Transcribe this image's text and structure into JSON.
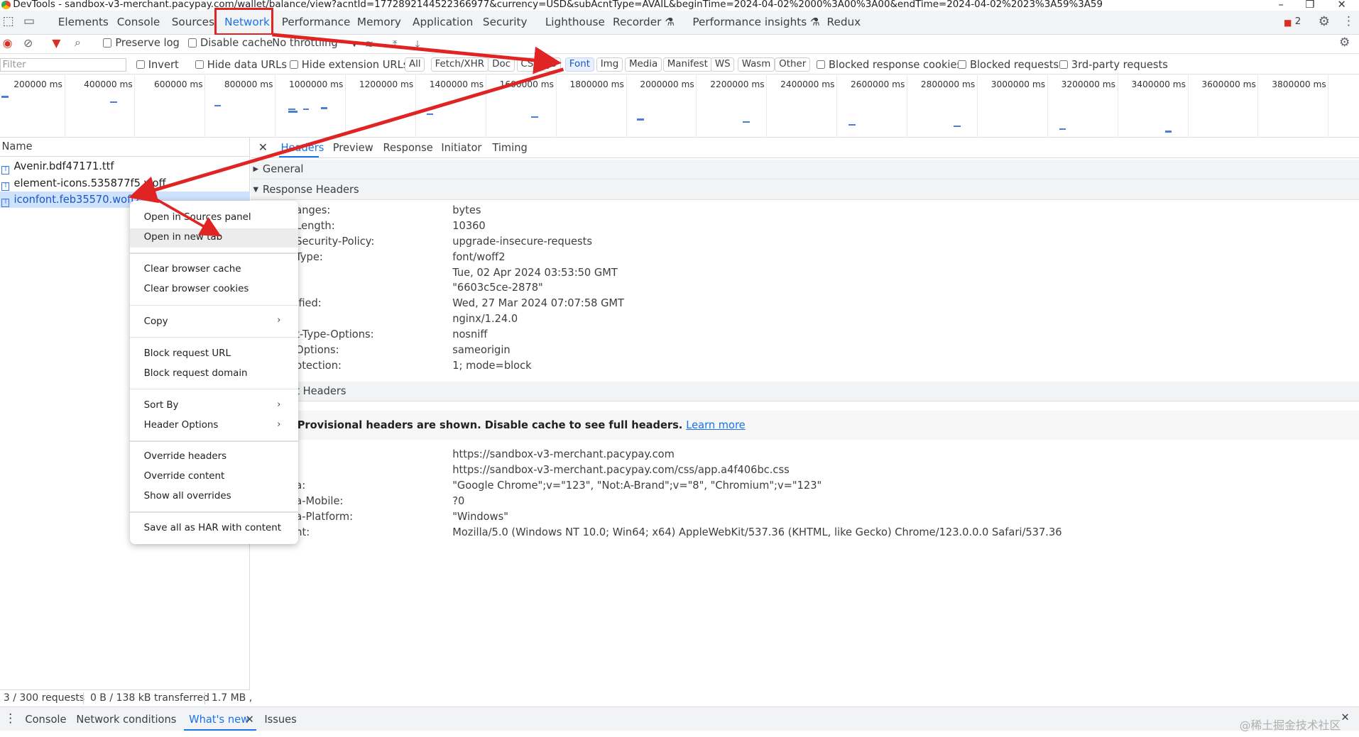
{
  "window": {
    "title": "DevTools - sandbox-v3-merchant.pacypay.com/wallet/balance/view?acntId=1772892144522366977&currency=USD&subAcntType=AVAIL&beginTime=2024-04-02%2000%3A00%3A00&endTime=2024-04-02%2023%3A59%3A59",
    "minimize": "–",
    "restore": "❐",
    "close": "✕"
  },
  "topbar": {
    "tabs": [
      "Elements",
      "Console",
      "Sources",
      "Network",
      "Performance",
      "Memory",
      "Application",
      "Security",
      "Lighthouse",
      "Recorder ⚗",
      "Performance insights ⚗",
      "Redux"
    ],
    "active_tab": "Network",
    "error_count": "2"
  },
  "toolbar": {
    "preserve_log": "Preserve log",
    "disable_cache": "Disable cache",
    "throttling": "No throttling"
  },
  "filterbar": {
    "filter_placeholder": "Filter",
    "invert": "Invert",
    "hide_data_urls": "Hide data URLs",
    "hide_extension_urls": "Hide extension URLs",
    "types": [
      "All",
      "Fetch/XHR",
      "Doc",
      "CSS",
      "JS",
      "Font",
      "Img",
      "Media",
      "Manifest",
      "WS",
      "Wasm",
      "Other"
    ],
    "active_type": "Font",
    "blocked_response_cookies": "Blocked response cookies",
    "blocked_requests": "Blocked requests",
    "third_party_requests": "3rd-party requests"
  },
  "timeline": {
    "ticks": [
      "200000 ms",
      "400000 ms",
      "600000 ms",
      "800000 ms",
      "1000000 ms",
      "1200000 ms",
      "1400000 ms",
      "1600000 ms",
      "1800000 ms",
      "2000000 ms",
      "2200000 ms",
      "2400000 ms",
      "2600000 ms",
      "2800000 ms",
      "3000000 ms",
      "3200000 ms",
      "3400000 ms",
      "3600000 ms",
      "3800000 ms"
    ]
  },
  "requests": {
    "header": "Name",
    "items": [
      "Avenir.bdf47171.ttf",
      "element-icons.535877f5.woff",
      "iconfont.feb35570.woff2"
    ],
    "selected_index": 2
  },
  "details": {
    "tabs": [
      "Headers",
      "Preview",
      "Response",
      "Initiator",
      "Timing"
    ],
    "active_tab": "Headers",
    "general": "General",
    "response_headers_title": "Response Headers",
    "response_headers": [
      {
        "k": "anges:",
        "v": "bytes"
      },
      {
        "k": "Length:",
        "v": "10360"
      },
      {
        "k": "Security-Policy:",
        "v": "upgrade-insecure-requests"
      },
      {
        "k": "Type:",
        "v": "font/woff2"
      },
      {
        "k": "",
        "v": "Tue, 02 Apr 2024 03:53:50 GMT"
      },
      {
        "k": "",
        "v": "\"6603c5ce-2878\""
      },
      {
        "k": "ified:",
        "v": "Wed, 27 Mar 2024 07:07:58 GMT"
      },
      {
        "k": "",
        "v": "nginx/1.24.0"
      },
      {
        "k": "t-Type-Options:",
        "v": "nosniff"
      },
      {
        "k": "Options:",
        "v": "sameorigin"
      },
      {
        "k": "otection:",
        "v": "1; mode=block"
      }
    ],
    "request_headers_title": "t Headers",
    "provisional_warning": "Provisional headers are shown. Disable cache to see full headers.",
    "learn_more": "Learn more",
    "request_headers": [
      {
        "k": "",
        "v": "https://sandbox-v3-merchant.pacypay.com"
      },
      {
        "k": "",
        "v": "https://sandbox-v3-merchant.pacypay.com/css/app.a4f406bc.css"
      },
      {
        "k": "a:",
        "v": "\"Google Chrome\";v=\"123\", \"Not:A-Brand\";v=\"8\", \"Chromium\";v=\"123\""
      },
      {
        "k": "a-Mobile:",
        "v": "?0"
      },
      {
        "k": "a-Platform:",
        "v": "\"Windows\""
      },
      {
        "k": "nt:",
        "v": "Mozilla/5.0 (Windows NT 10.0; Win64; x64) AppleWebKit/537.36 (KHTML, like Gecko) Chrome/123.0.0.0 Safari/537.36"
      }
    ]
  },
  "context_menu": {
    "items": [
      "Open in Sources panel",
      "Open in new tab",
      "Clear browser cache",
      "Clear browser cookies",
      "Copy",
      "Block request URL",
      "Block request domain",
      "Sort By",
      "Header Options",
      "Override headers",
      "Override content",
      "Show all overrides",
      "Save all as HAR with content"
    ],
    "highlighted": "Open in new tab"
  },
  "statusbar": {
    "requests": "3 / 300 requests",
    "transferred": "0 B / 138 kB transferred",
    "resources": "1.7 MB ,"
  },
  "drawer": {
    "tabs": [
      "Console",
      "Network conditions",
      "What's new",
      "Issues"
    ],
    "active_tab": "What's new"
  },
  "watermark": "@稀土掘金技术社区",
  "colors": {
    "accent": "#1a73e8",
    "annotation": "#e02424",
    "selected_row": "#cfe2fc"
  }
}
